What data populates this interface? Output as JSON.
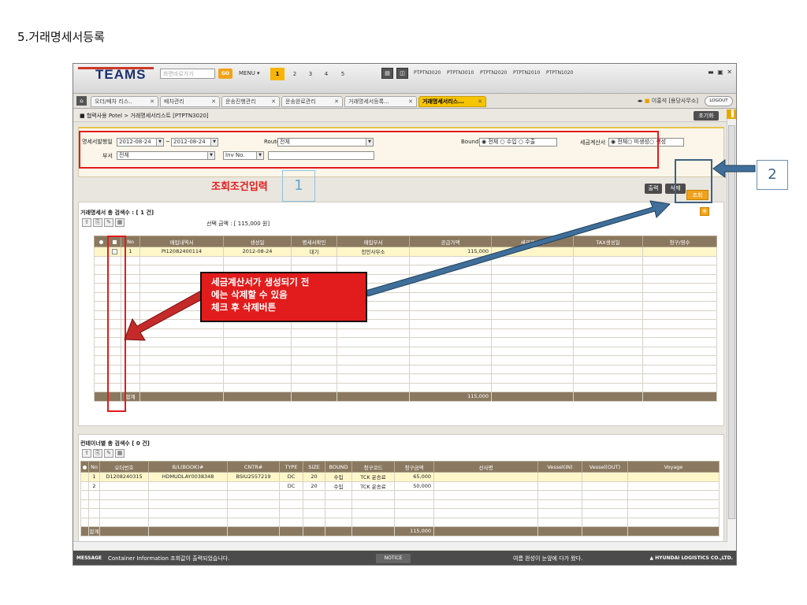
{
  "doc_title": "5.거래명세서등록",
  "app": {
    "logo": "TEAMS",
    "quick_nav_placeholder": "화면바로가기",
    "go_label": "GO",
    "menu_label": "MENU ▾",
    "num_tabs": [
      "1",
      "2",
      "3",
      "4",
      "5"
    ],
    "program_codes": [
      "PTPTN3020",
      "PTPTN3010",
      "PTPTN2020",
      "PTPTN2010",
      "PTPTN1020"
    ],
    "tabs": [
      {
        "label": "오더/배차 리스..",
        "close": "✕"
      },
      {
        "label": "배차관리",
        "close": "✕"
      },
      {
        "label": "운송진행관리",
        "close": "✕"
      },
      {
        "label": "운송완료관리",
        "close": "✕"
      },
      {
        "label": "거래명세서등록...",
        "close": "✕"
      },
      {
        "label": "거래명세서리스...",
        "close": "✕"
      }
    ],
    "user": "이홍석 [용당사무소]",
    "logout": "LOGOUT",
    "breadcrumb": "협력사용 Potel > 거래명세서리스트 [PTPTN3020]",
    "reset_label": "초기화"
  },
  "search": {
    "issue_date_label": "명세서발행일",
    "date_from": "2012-08-24",
    "date_sep": "~",
    "date_to": "2012-08-24",
    "route_label": "Route",
    "route_value": "전체",
    "bound_label": "Bound",
    "bound_options": "◉ 전체 ○ 수입 ○ 수출",
    "tax_label": "세금계산서",
    "tax_options": "◉ 전체○ 미생성○ 생성",
    "dept_label": "부서",
    "dept_value": "전체",
    "inv_select": "Inv No.",
    "search_label": "조회",
    "print_label": "출력",
    "delete_label": "삭제"
  },
  "annotations": {
    "search_condition": "조회조건입력",
    "step1": "1",
    "step2": "2",
    "note_lines": [
      "세금계산서가 생성되기 전",
      "에는 삭제할 수 있음",
      "체크 후 삭제버튼"
    ]
  },
  "statement_panel": {
    "title": "거래명세서 총 검색수 : [ 1 건]",
    "selected_amount": "선택 금액 : [ 115,000 원]",
    "columns": [
      "●",
      "■",
      "No",
      "매입내역서",
      "생성일",
      "명세서확인",
      "매입부서",
      "공급가액",
      "세금계산서",
      "TAX생성일",
      "청구/영수"
    ],
    "rows": [
      [
        "",
        "☐",
        "1",
        "PI12082400114",
        "2012-08-24",
        "대기",
        "천안사무소",
        "115,000",
        "",
        "",
        ""
      ]
    ],
    "total_label": "합계",
    "total_amount": "115,000"
  },
  "container_panel": {
    "title": "컨테이너별 총 검색수 [ 0 건]",
    "columns": [
      "●",
      "No",
      "오더번호",
      "B/L(BOOK)#",
      "CNTR#",
      "TYPE",
      "SIZE",
      "BOUND",
      "청구코드",
      "청구금액",
      "선사명",
      "Vessel(IN)",
      "Vessel(OUT)",
      "Voyage"
    ],
    "rows": [
      [
        "",
        "1",
        "D1208240315",
        "HDMUDLAY0038348",
        "BSIU2557219",
        "DC",
        "20",
        "수입",
        "TCK 운송료",
        "65,000",
        "",
        "",
        "",
        ""
      ],
      [
        "",
        "2",
        "",
        "",
        "",
        "DC",
        "20",
        "수입",
        "TCK 운송료",
        "50,000",
        "",
        "",
        "",
        ""
      ]
    ],
    "total_label": "합계",
    "total_amount": "115,000"
  },
  "statusbar": {
    "message_tag": "MESSAGE",
    "message": "Container Information 조회값이 출력되었습니다.",
    "notice_tag": "NOTICE",
    "notice": "여름 완성이 눈앞에 다가 왔다.",
    "brand": "▲ HYUNDAI LOGISTICS CO.,LTD."
  },
  "colors": {
    "accent_yellow": "#f7c400",
    "search_orange": "#f0a21c",
    "grid_header": "#8a7960",
    "annotation_red": "#e21c1c",
    "annotation_blue": "#40637f"
  }
}
